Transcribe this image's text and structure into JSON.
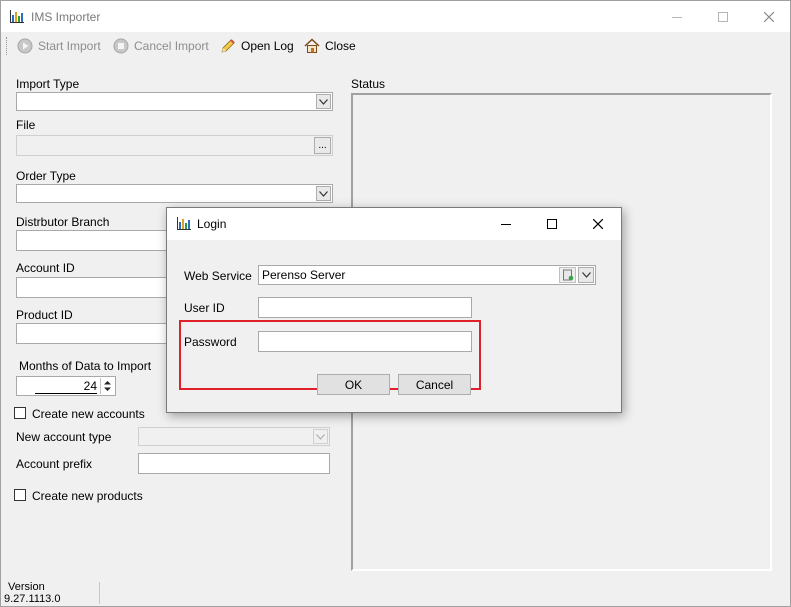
{
  "window": {
    "title": "IMS Importer"
  },
  "toolbar": {
    "start_import": "Start Import",
    "cancel_import": "Cancel Import",
    "open_log": "Open Log",
    "close": "Close"
  },
  "form": {
    "import_type_label": "Import Type",
    "file_label": "File",
    "file_browse": "...",
    "order_type_label": "Order Type",
    "branch_label": "Distrbutor Branch",
    "account_id_label": "Account ID",
    "product_id_label": "Product ID",
    "months_label": "Months of Data to Import",
    "months_value": "24",
    "create_accounts_label": "Create new accounts",
    "new_account_type_label": "New account type",
    "account_prefix_label": "Account prefix",
    "create_products_label": "Create new products"
  },
  "status": {
    "label": "Status"
  },
  "footer": {
    "version_label": "Version",
    "version_value": "9.27.1113.0"
  },
  "login": {
    "title": "Login",
    "web_service_label": "Web Service",
    "web_service_value": "Perenso Server",
    "user_id_label": "User ID",
    "password_label": "Password",
    "ok": "OK",
    "cancel": "Cancel"
  },
  "colors": {
    "highlight": "#e0202a",
    "window_bg": "#f0f0f0"
  },
  "icons": [
    "app-chart-icon",
    "play-icon",
    "stop-icon",
    "pencil-icon",
    "home-icon",
    "minimize-icon",
    "maximize-icon",
    "close-icon",
    "chevron-down-icon",
    "server-icon"
  ]
}
